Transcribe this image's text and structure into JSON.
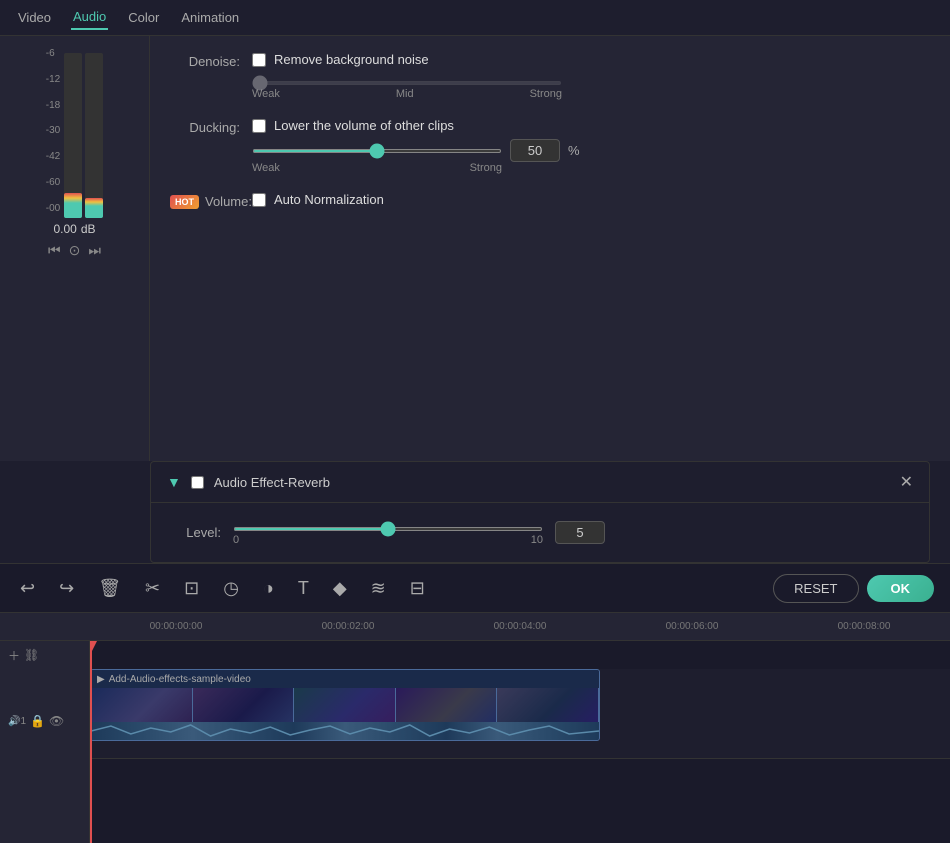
{
  "tabs": {
    "items": [
      {
        "id": "video",
        "label": "Video"
      },
      {
        "id": "audio",
        "label": "Audio",
        "active": true
      },
      {
        "id": "color",
        "label": "Color"
      },
      {
        "id": "animation",
        "label": "Animation"
      }
    ]
  },
  "denoise": {
    "label": "Denoise:",
    "checkbox_label": "Remove background noise",
    "slider_min": "Weak",
    "slider_mid": "Mid",
    "slider_max": "Strong",
    "slider_value": 0,
    "slider_position_pct": 0
  },
  "ducking": {
    "label": "Ducking:",
    "checkbox_label": "Lower the volume of other clips",
    "slider_min": "Weak",
    "slider_max": "Strong",
    "slider_value": 50,
    "slider_position_pct": 50,
    "input_value": "50",
    "percent_label": "%"
  },
  "volume": {
    "label": "Volume:",
    "hot_badge": "HOT",
    "checkbox_label": "Auto Normalization"
  },
  "audio_effect": {
    "title": "Audio Effect-Reverb",
    "level_label": "Level:",
    "slider_min": "0",
    "slider_max": "10",
    "slider_value": 5,
    "slider_position_pct": 50,
    "input_value": "5"
  },
  "meter": {
    "db_value": "0.00",
    "db_unit": "dB",
    "left_fill_pct": 15,
    "right_fill_pct": 12,
    "labels": [
      "-6",
      "-12",
      "-18",
      "-30",
      "-42",
      "-60",
      "-00"
    ]
  },
  "toolbar": {
    "reset_label": "RESET",
    "ok_label": "OK"
  },
  "timeline": {
    "markers": [
      "00:00:00:00",
      "00:00:02:00",
      "00:00:04:00",
      "00:00:06:00",
      "00:00:08:00"
    ],
    "clip_title": "Add-Audio-effects-sample-video",
    "track_icons": [
      "🔒",
      "👁"
    ]
  },
  "icons": {
    "undo": "↩",
    "redo": "↪",
    "delete": "🗑",
    "scissors": "✂",
    "crop": "⊡",
    "speed": "◷",
    "color": "◑",
    "text": "T",
    "keyframe": "◆",
    "audio": "≋",
    "equalizer": "⊟",
    "playhead_play": "▶",
    "lock": "🔒",
    "eye": "👁",
    "add_track": "＋",
    "link": "⛓",
    "collapse": "▼",
    "close": "✕"
  }
}
